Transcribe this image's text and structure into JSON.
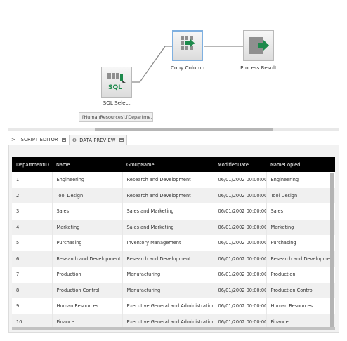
{
  "canvas": {
    "nodes": {
      "sql_select": {
        "label": "SQL Select",
        "icon": "database-sql-icon"
      },
      "copy_column": {
        "label": "Copy Column",
        "icon": "copy-column-icon"
      },
      "process_result": {
        "label": "Process Result",
        "icon": "process-result-icon"
      }
    },
    "tooltip": "[HumanResources].[Departme..."
  },
  "tabs": [
    {
      "label": "SCRIPT EDITOR",
      "icon": "script-icon"
    },
    {
      "label": "DATA PREVIEW",
      "icon": "data-preview-icon"
    }
  ],
  "grid": {
    "columns": [
      "DepartmentID",
      "Name",
      "GroupName",
      "ModifiedDate",
      "NameCopied"
    ],
    "rows": [
      [
        "1",
        "Engineering",
        "Research and Development",
        "06/01/2002 00:00:00",
        "Engineering"
      ],
      [
        "2",
        "Tool Design",
        "Research and Development",
        "06/01/2002 00:00:00",
        "Tool Design"
      ],
      [
        "3",
        "Sales",
        "Sales and Marketing",
        "06/01/2002 00:00:00",
        "Sales"
      ],
      [
        "4",
        "Marketing",
        "Sales and Marketing",
        "06/01/2002 00:00:00",
        "Marketing"
      ],
      [
        "5",
        "Purchasing",
        "Inventory Management",
        "06/01/2002 00:00:00",
        "Purchasing"
      ],
      [
        "6",
        "Research and Development",
        "Research and Development",
        "06/01/2002 00:00:00",
        "Research and Development"
      ],
      [
        "7",
        "Production",
        "Manufacturing",
        "06/01/2002 00:00:00",
        "Production"
      ],
      [
        "8",
        "Production Control",
        "Manufacturing",
        "06/01/2002 00:00:00",
        "Production Control"
      ],
      [
        "9",
        "Human Resources",
        "Executive General and Administration",
        "06/01/2002 00:00:00",
        "Human Resources"
      ],
      [
        "10",
        "Finance",
        "Executive General and Administration",
        "06/01/2002 00:00:00",
        "Finance"
      ]
    ]
  },
  "colors": {
    "accent_green": "#1e8a4c",
    "selection_border": "#7fb0e0",
    "header_bg": "#000000"
  }
}
